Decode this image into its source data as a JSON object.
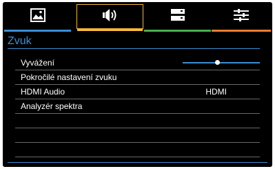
{
  "tabs": [
    {
      "icon": "picture-icon",
      "color": "#3b8fd6",
      "active": false
    },
    {
      "icon": "speaker-icon",
      "color": "#f6b93a",
      "active": true
    },
    {
      "icon": "setup-icon",
      "color": "#4caf50",
      "active": false
    },
    {
      "icon": "sliders-icon",
      "color": "#f47c30",
      "active": false
    }
  ],
  "menu": {
    "title": "Zvuk",
    "items": [
      {
        "label": "Vyvážení",
        "value": "",
        "balance": 0.45
      },
      {
        "label": "Pokročilé nastavení zvuku",
        "value": ""
      },
      {
        "label": "HDMI Audio",
        "value": "HDMI"
      },
      {
        "label": "Analyzér spektra",
        "value": ""
      },
      {
        "label": "",
        "value": ""
      },
      {
        "label": "",
        "value": ""
      },
      {
        "label": "",
        "value": ""
      },
      {
        "label": "",
        "value": ""
      }
    ]
  },
  "colors": {
    "accent": "#3b8fd6",
    "background": "#000000",
    "active_tab": "#f6b93a"
  }
}
